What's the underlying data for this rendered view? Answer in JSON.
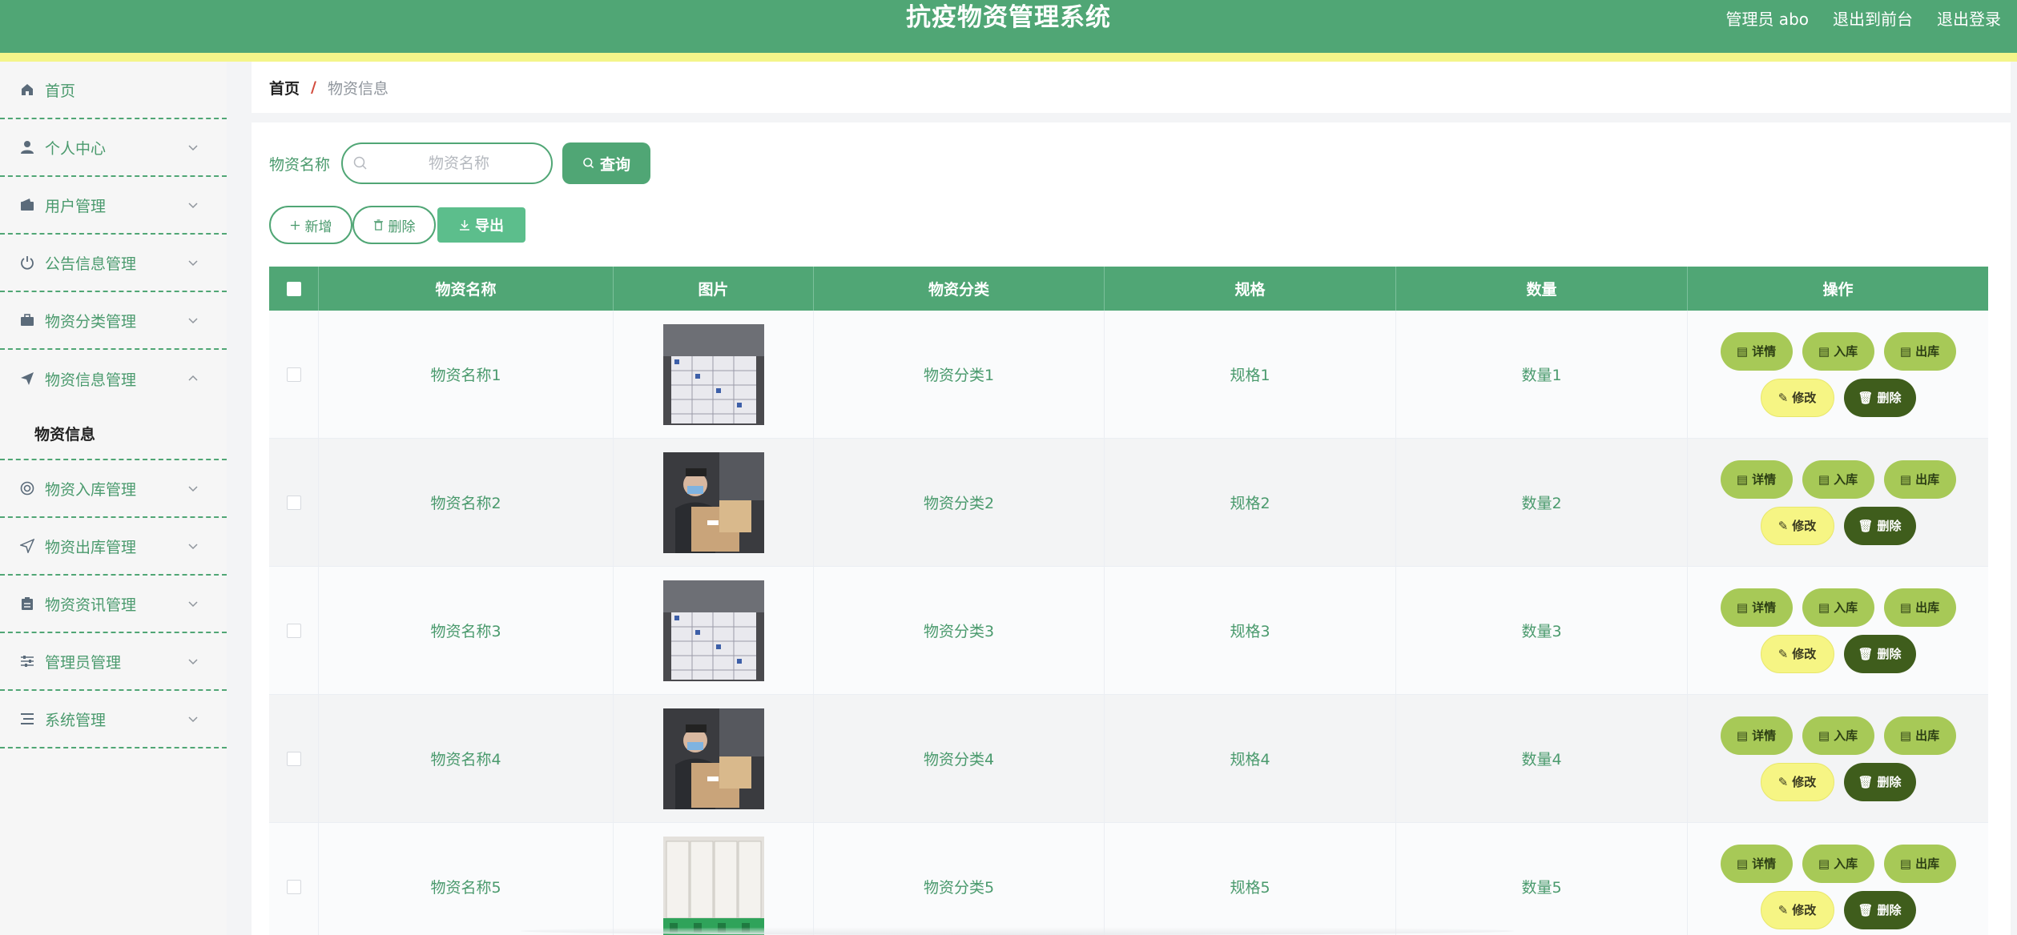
{
  "header": {
    "title": "抗疫物资管理系统",
    "admin_label": "管理员 abo",
    "frontend_link": "退出到前台",
    "logout_link": "退出登录"
  },
  "sidebar": {
    "items": [
      {
        "label": "首页",
        "icon": "home-icon"
      },
      {
        "label": "个人中心",
        "icon": "user-icon"
      },
      {
        "label": "用户管理",
        "icon": "wallet-icon"
      },
      {
        "label": "公告信息管理",
        "icon": "power-icon"
      },
      {
        "label": "物资分类管理",
        "icon": "briefcase-icon"
      },
      {
        "label": "物资信息管理",
        "icon": "send-icon"
      },
      {
        "label": "物资入库管理",
        "icon": "lifebuoy-icon"
      },
      {
        "label": "物资出库管理",
        "icon": "location-arrow-icon"
      },
      {
        "label": "物资资讯管理",
        "icon": "clipboard-icon"
      },
      {
        "label": "管理员管理",
        "icon": "sliders-icon"
      },
      {
        "label": "系统管理",
        "icon": "list-icon"
      }
    ],
    "submenu_label": "物资信息"
  },
  "breadcrumb": {
    "home": "首页",
    "separator": "/",
    "current": "物资信息"
  },
  "search": {
    "label": "物资名称",
    "placeholder": "物资名称",
    "value": "",
    "query_button": "查询"
  },
  "actions": {
    "new_button": "新增",
    "delete_button": "删除",
    "export_button": "导出"
  },
  "table": {
    "columns": [
      "物资名称",
      "图片",
      "物资分类",
      "规格",
      "数量",
      "操作"
    ],
    "rows": [
      {
        "name": "物资名称1",
        "category": "物资分类1",
        "spec": "规格1",
        "qty": "数量1",
        "image": "boxes-stack"
      },
      {
        "name": "物资名称2",
        "category": "物资分类2",
        "spec": "规格2",
        "qty": "数量2",
        "image": "person-with-box"
      },
      {
        "name": "物资名称3",
        "category": "物资分类3",
        "spec": "规格3",
        "qty": "数量3",
        "image": "boxes-stack"
      },
      {
        "name": "物资名称4",
        "category": "物资分类4",
        "spec": "规格4",
        "qty": "数量4",
        "image": "person-with-box"
      },
      {
        "name": "物资名称5",
        "category": "物资分类5",
        "spec": "规格5",
        "qty": "数量5",
        "image": "warehouse-pallets"
      }
    ],
    "row_actions": {
      "detail": "详情",
      "stock_in": "入库",
      "stock_out": "出库",
      "edit": "修改",
      "delete": "删除"
    }
  },
  "colors": {
    "primary": "#50a675",
    "accent_stripe": "#f4f58a",
    "lime_button": "#a7c957",
    "yellow_button": "#f6f584",
    "dark_button": "#3f5d1c"
  }
}
